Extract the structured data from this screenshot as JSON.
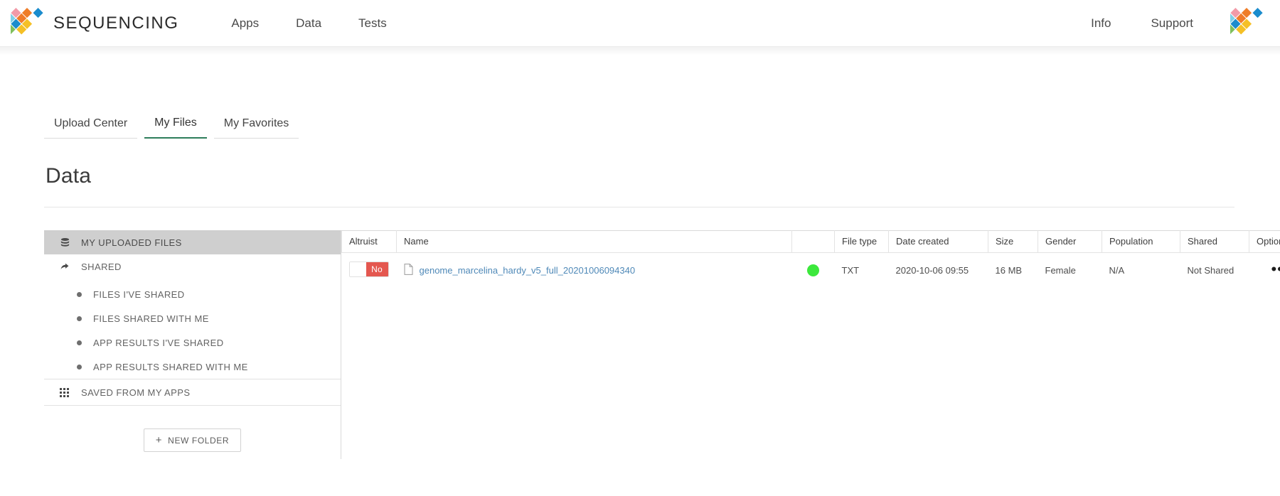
{
  "brand": {
    "name": "SEQUENCING",
    "logo_icon": "sequencing-diamond-logo"
  },
  "nav": {
    "main": [
      {
        "label": "Apps"
      },
      {
        "label": "Data"
      },
      {
        "label": "Tests"
      }
    ],
    "right": [
      {
        "label": "Info"
      },
      {
        "label": "Support"
      }
    ]
  },
  "tabs": [
    {
      "label": "Upload Center",
      "active": false
    },
    {
      "label": "My Files",
      "active": true
    },
    {
      "label": "My Favorites",
      "active": false
    }
  ],
  "page": {
    "title": "Data"
  },
  "sidebar": {
    "items": [
      {
        "label": "MY UPLOADED FILES",
        "icon": "database-icon",
        "level": 0,
        "selected": true
      },
      {
        "label": "SHARED",
        "icon": "share-arrow-icon",
        "level": 0,
        "selected": false
      },
      {
        "label": "FILES I'VE SHARED",
        "icon": "bullet-dot",
        "level": 1,
        "selected": false
      },
      {
        "label": "FILES SHARED WITH ME",
        "icon": "bullet-dot",
        "level": 1,
        "selected": false
      },
      {
        "label": "APP RESULTS I'VE SHARED",
        "icon": "bullet-dot",
        "level": 1,
        "selected": false
      },
      {
        "label": "APP RESULTS SHARED WITH ME",
        "icon": "bullet-dot",
        "level": 1,
        "selected": false
      },
      {
        "label": "SAVED FROM MY APPS",
        "icon": "grid-apps-icon",
        "level": 0,
        "selected": false
      }
    ],
    "new_folder_button": {
      "label": "NEW FOLDER",
      "icon": "plus-icon"
    }
  },
  "table": {
    "columns": [
      "Altruist",
      "Name",
      "",
      "File type",
      "Date created",
      "Size",
      "Gender",
      "Population",
      "Shared",
      "Options"
    ],
    "rows": [
      {
        "altruist": "No",
        "name": "genome_marcelina_hardy_v5_full_20201006094340",
        "name_icon": "file-icon",
        "status_icon": "green-status-dot",
        "file_type": "TXT",
        "date_created": "2020-10-06 09:55",
        "size": "16 MB",
        "gender": "Female",
        "population": "N/A",
        "shared": "Not Shared",
        "options_icon": "ellipsis-icon"
      }
    ]
  },
  "colors": {
    "tab_active_underline": "#2e7d5b",
    "altruist_off": "#e4574f",
    "status_green": "#3ce83c",
    "link_blue": "#4f89b8",
    "sidebar_selected": "#cfcfcf"
  }
}
